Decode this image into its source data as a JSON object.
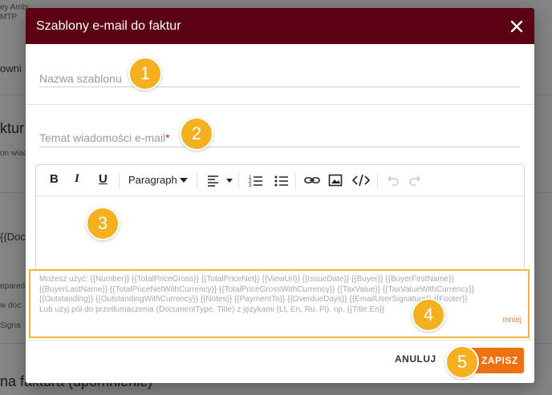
{
  "background": {
    "lines": [
      {
        "text": "ey Ambi",
        "style": "small"
      },
      {
        "text": "MTP",
        "style": "small"
      },
      {
        "text": "owni",
        "style": "mid"
      },
      {
        "text": "ktur",
        "style": "big"
      },
      {
        "text": "on wiad",
        "style": "small"
      },
      {
        "text": "{{Doc",
        "style": "mid"
      },
      {
        "text": "epared",
        "style": "small"
      },
      {
        "text": "w doc",
        "style": "small"
      },
      {
        "text": "Signa",
        "style": "small"
      },
      {
        "text": "na faktura (upomnienie)",
        "style": "big"
      }
    ]
  },
  "dialog": {
    "title": "Szablony e-mail do faktur",
    "close_icon": "close-icon"
  },
  "fields": {
    "template_name": {
      "placeholder": "Nazwa szablonu",
      "value": ""
    },
    "email_subject": {
      "placeholder": "Temat wiadomości e-mail",
      "required_marker": "*",
      "value": ""
    }
  },
  "editor": {
    "toolbar": {
      "bold": "B",
      "italic": "I",
      "underline": "U",
      "block_format": "Paragraph",
      "icons": [
        "align-left-icon",
        "ordered-list-icon",
        "bullet-list-icon",
        "link-icon",
        "image-icon",
        "code-icon",
        "undo-icon",
        "redo-icon"
      ]
    },
    "content": ""
  },
  "hint": {
    "line1": "Możesz użyć: {{Number}} {{TotalPriceGross}} {{TotalPriceNet}} {{ViewUrl}} {{IssueDate}} {{Buyer}} {{BuyerFirstName}}",
    "line2": "{{BuyerLastName}} {{TotalPriceNetWithCurrency}} {{TotalPriceGrossWithCurrency}} {{TaxValue}} {{TaxValueWithCurrency}}",
    "line3": "{{Outstanding}} {{OutstandingWithCurrency}} {{Notes}} {{PaymentTo}} {{OverdueDays}} {{EmailUserSignature}} {{Footer}}",
    "line4": "Lub użyj pól do przetłumaczenia (DocumentType, Title) z językami (Lt, En, Ru, Pl). np. {{Title.En}}",
    "less_label": "mniej"
  },
  "footer": {
    "cancel_label": "ANULUJ",
    "save_label": "ZAPISZ"
  },
  "badges": [
    "1",
    "2",
    "3",
    "4",
    "5"
  ],
  "colors": {
    "header": "#5c0014",
    "accent": "#ef7212",
    "badge": "#f5b01f",
    "highlight_border": "#f0b63a"
  }
}
